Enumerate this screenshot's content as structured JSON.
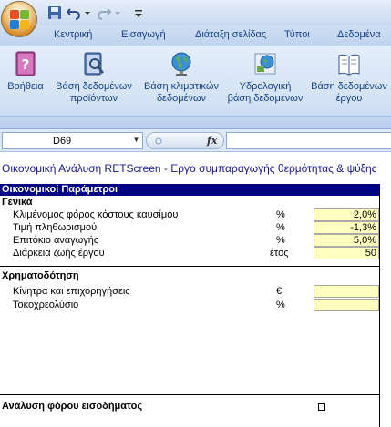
{
  "tabs": [
    "Κεντρική",
    "Εισαγωγή",
    "Διάταξη σελίδας",
    "Τύποι",
    "Δεδομένα"
  ],
  "ribbon": {
    "buttons": [
      {
        "label_line1": "Βοήθεια",
        "label_line2": "",
        "icon": "help-book-icon"
      },
      {
        "label_line1": "Βάση δεδομένων",
        "label_line2": "προϊόντων",
        "icon": "product-database-icon"
      },
      {
        "label_line1": "Βάση κλιματικών",
        "label_line2": "δεδομένων",
        "icon": "globe-icon"
      },
      {
        "label_line1": "Υδρολογική",
        "label_line2": "βάση δεδομένων",
        "icon": "hydrology-map-icon"
      },
      {
        "label_line1": "Βάση δεδομένων",
        "label_line2": "έργου",
        "icon": "project-book-icon"
      }
    ]
  },
  "formula_bar": {
    "name_box": "D69",
    "fx": "fx",
    "formula": ""
  },
  "sheet": {
    "title": "Οικονομική Ανάλυση RETScreen - Εργο συμπαραγωγής θερμότητας & ψύξης",
    "section_header": "Οικονομικοί Παράμετροι",
    "general": {
      "title": "Γενικά",
      "rows": [
        {
          "label": "Κλιμένομος φόρος κόστους καυσίμου",
          "unit": "%",
          "value": "2,0%"
        },
        {
          "label": "Τιμή πληθωρισμού",
          "unit": "%",
          "value": "-1,3%"
        },
        {
          "label": "Επιτόκιο αναγωγής",
          "unit": "%",
          "value": "5,0%"
        },
        {
          "label": "Διάρκεια ζωής έργου",
          "unit": "έτος",
          "value": "50"
        }
      ]
    },
    "financing": {
      "title": "Χρηματοδότηση",
      "rows": [
        {
          "label": "Κίνητρα και επιχορηγήσεις",
          "unit": "€",
          "value": ""
        },
        {
          "label": "Τοκοχρεολύσιο",
          "unit": "%",
          "value": ""
        }
      ]
    },
    "tax": {
      "title": "Ανάλυση φόρου εισοδήματος",
      "checked": false
    }
  },
  "colors": {
    "section_bar": "#000080",
    "input_cell": "#ffffc0",
    "title_text": "#1a1a8c",
    "tab_text": "#15428b"
  }
}
